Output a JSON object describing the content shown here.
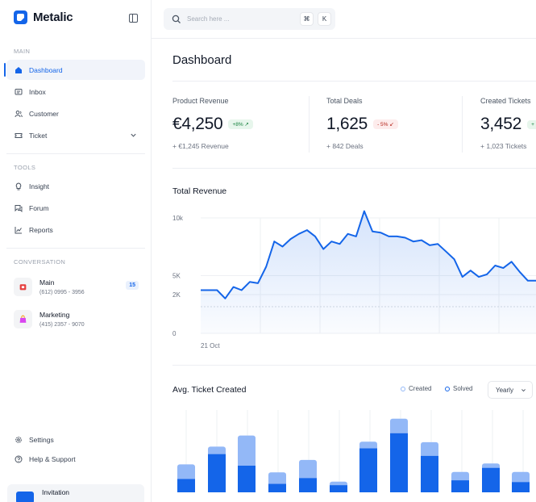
{
  "app": {
    "name": "Metalic"
  },
  "search": {
    "placeholder": "Search here ...",
    "shortcut_keys": [
      "⌘",
      "K"
    ]
  },
  "sidebar": {
    "sections": [
      {
        "label": "MAIN",
        "items": [
          {
            "label": "Dashboard",
            "icon": "home-icon",
            "active": true
          },
          {
            "label": "Inbox",
            "icon": "inbox-icon"
          },
          {
            "label": "Customer",
            "icon": "users-icon"
          },
          {
            "label": "Ticket",
            "icon": "ticket-icon",
            "expandable": true
          }
        ]
      },
      {
        "label": "TOOLS",
        "items": [
          {
            "label": "Insight",
            "icon": "bulb-icon"
          },
          {
            "label": "Forum",
            "icon": "forum-icon"
          },
          {
            "label": "Reports",
            "icon": "chart-line-icon"
          }
        ]
      },
      {
        "label": "CONVERSATION",
        "items": []
      }
    ],
    "conversations": [
      {
        "name": "Main",
        "phone": "(612) 0995 - 3956",
        "badge": "15",
        "color": "#e53e3e"
      },
      {
        "name": "Marketing",
        "phone": "(415) 2357 - 9070",
        "badge": "",
        "color": "#d946ef"
      }
    ],
    "footer_items": [
      {
        "label": "Settings",
        "icon": "gear-icon"
      },
      {
        "label": "Help & Support",
        "icon": "help-icon"
      }
    ],
    "invitation": {
      "label": "Invitation"
    }
  },
  "page": {
    "title": "Dashboard"
  },
  "stats": [
    {
      "label": "Product Revenue",
      "value": "€4,250",
      "badge": "+8% ↗",
      "trend": "up",
      "sub": "+ €1,245 Revenue"
    },
    {
      "label": "Total Deals",
      "value": "1,625",
      "badge": "- 5% ↙",
      "trend": "down",
      "sub": "+ 842 Deals"
    },
    {
      "label": "Created Tickets",
      "value": "3,452",
      "badge": "+",
      "trend": "up",
      "sub": "+ 1,023 Tickets"
    }
  ],
  "colors": {
    "accent": "#1465e9",
    "accent_light": "#93b8f7"
  },
  "chart_data": [
    {
      "type": "area",
      "title": "Total Revenue",
      "ylim": [
        0,
        10000
      ],
      "ytick_labels": [
        "10k",
        "5K",
        "2K",
        "0"
      ],
      "xtick_labels": [
        "21 Oct"
      ],
      "reference_line": 2000,
      "grid": true,
      "y": [
        2350,
        2350,
        2350,
        1800,
        2600,
        2350,
        3000,
        2900,
        4200,
        6200,
        5800,
        6400,
        6800,
        7100,
        6600,
        5600,
        6200,
        6000,
        6800,
        6600,
        8600,
        7000,
        6900,
        6600,
        6600,
        6500,
        6200,
        6300,
        5900,
        6000,
        5400,
        4800,
        3400,
        3900,
        3400,
        3600,
        4300,
        4100,
        4600,
        3800,
        3100,
        3100
      ]
    },
    {
      "type": "bar",
      "title": "Avg. Ticket Created",
      "stacked": true,
      "legend": "top-right",
      "series": [
        {
          "name": "Solved",
          "values": [
            30,
            86,
            60,
            19,
            32,
            16,
            99,
            133,
            82,
            27,
            55,
            23
          ]
        },
        {
          "name": "Created",
          "values": [
            33,
            17,
            68,
            26,
            41,
            8,
            15,
            33,
            31,
            19,
            10,
            23
          ]
        }
      ],
      "period": "Yearly"
    }
  ]
}
